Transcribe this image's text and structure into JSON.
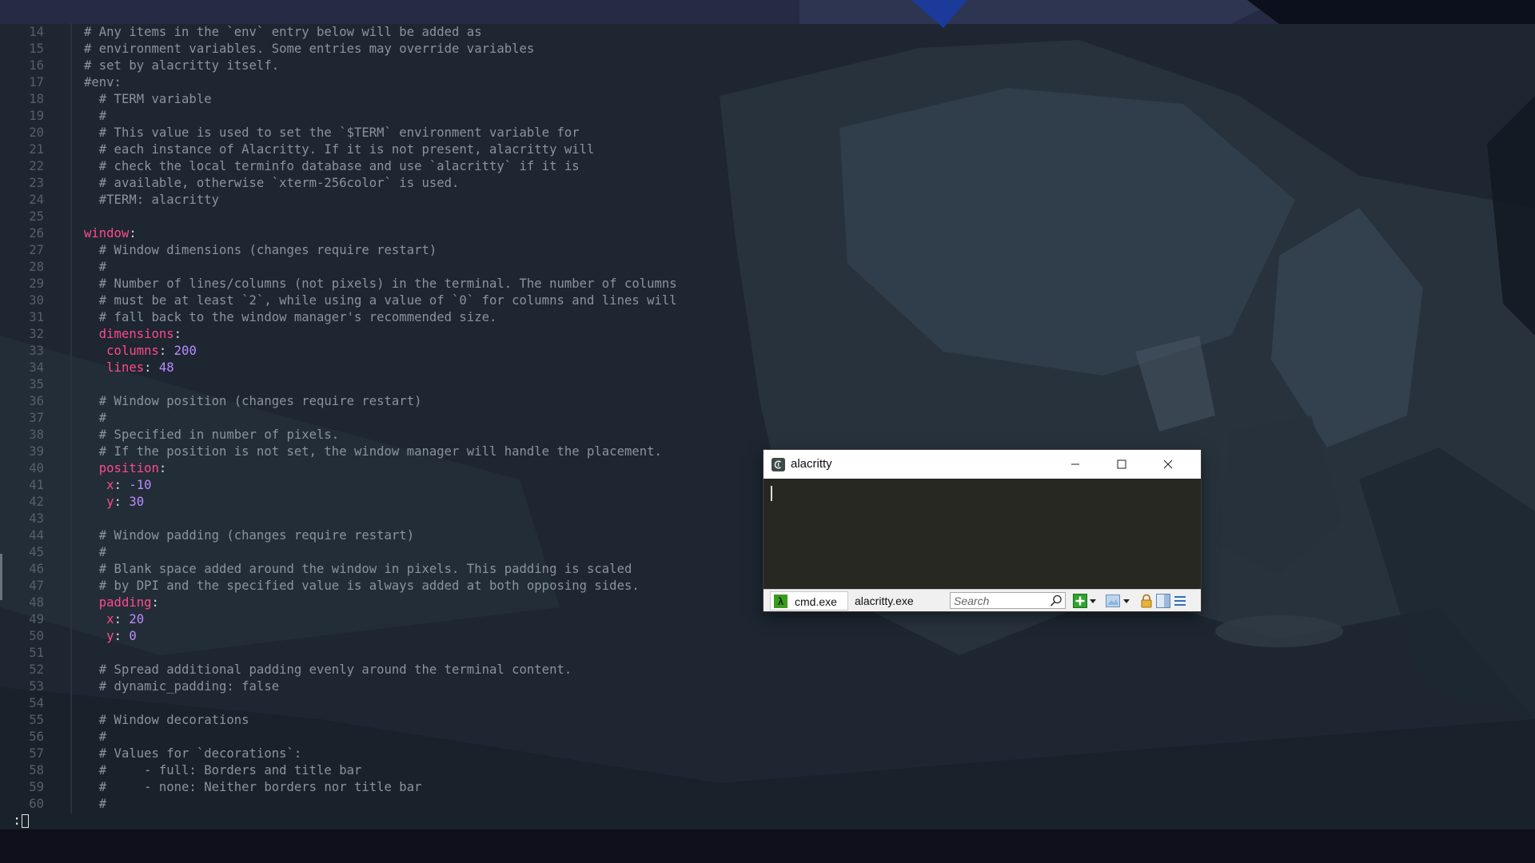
{
  "editor": {
    "lines": [
      {
        "n": "14",
        "s": [
          {
            "t": "# Any items in the `env` entry below will be added as",
            "c": "comment"
          }
        ]
      },
      {
        "n": "15",
        "s": [
          {
            "t": "# environment variables. Some entries may override variables",
            "c": "comment"
          }
        ]
      },
      {
        "n": "16",
        "s": [
          {
            "t": "# set by alacritty itself.",
            "c": "comment"
          }
        ]
      },
      {
        "n": "17",
        "s": [
          {
            "t": "#env:",
            "c": "comment"
          }
        ]
      },
      {
        "n": "18",
        "s": [
          {
            "t": "  # TERM variable",
            "c": "comment"
          }
        ]
      },
      {
        "n": "19",
        "s": [
          {
            "t": "  #",
            "c": "comment"
          }
        ]
      },
      {
        "n": "20",
        "s": [
          {
            "t": "  # This value is used to set the `$TERM` environment variable for",
            "c": "comment"
          }
        ]
      },
      {
        "n": "21",
        "s": [
          {
            "t": "  # each instance of Alacritty. If it is not present, alacritty will",
            "c": "comment"
          }
        ]
      },
      {
        "n": "22",
        "s": [
          {
            "t": "  # check the local terminfo database and use `alacritty` if it is",
            "c": "comment"
          }
        ]
      },
      {
        "n": "23",
        "s": [
          {
            "t": "  # available, otherwise `xterm-256color` is used.",
            "c": "comment"
          }
        ]
      },
      {
        "n": "24",
        "s": [
          {
            "t": "  #TERM: alacritty",
            "c": "comment"
          }
        ]
      },
      {
        "n": "25",
        "s": []
      },
      {
        "n": "26",
        "s": [
          {
            "t": "window",
            "c": "key"
          },
          {
            "t": ":",
            "c": "punct"
          }
        ]
      },
      {
        "n": "27",
        "s": [
          {
            "t": "  # Window dimensions (changes require restart)",
            "c": "comment"
          }
        ]
      },
      {
        "n": "28",
        "s": [
          {
            "t": "  #",
            "c": "comment"
          }
        ]
      },
      {
        "n": "29",
        "s": [
          {
            "t": "  # Number of lines/columns (not pixels) in the terminal. The number of columns",
            "c": "comment"
          }
        ]
      },
      {
        "n": "30",
        "s": [
          {
            "t": "  # must be at least `2`, while using a value of `0` for columns and lines will",
            "c": "comment"
          }
        ]
      },
      {
        "n": "31",
        "s": [
          {
            "t": "  # fall back to the window manager's recommended size.",
            "c": "comment"
          }
        ]
      },
      {
        "n": "32",
        "s": [
          {
            "t": "  dimensions",
            "c": "key"
          },
          {
            "t": ":",
            "c": "punct"
          }
        ]
      },
      {
        "n": "33",
        "s": [
          {
            "t": "   columns",
            "c": "key"
          },
          {
            "t": ": ",
            "c": "punct"
          },
          {
            "t": "200",
            "c": "num"
          }
        ]
      },
      {
        "n": "34",
        "s": [
          {
            "t": "   lines",
            "c": "key"
          },
          {
            "t": ": ",
            "c": "punct"
          },
          {
            "t": "48",
            "c": "num"
          }
        ]
      },
      {
        "n": "35",
        "s": []
      },
      {
        "n": "36",
        "s": [
          {
            "t": "  # Window position (changes require restart)",
            "c": "comment"
          }
        ]
      },
      {
        "n": "37",
        "s": [
          {
            "t": "  #",
            "c": "comment"
          }
        ]
      },
      {
        "n": "38",
        "s": [
          {
            "t": "  # Specified in number of pixels.",
            "c": "comment"
          }
        ]
      },
      {
        "n": "39",
        "s": [
          {
            "t": "  # If the position is not set, the window manager will handle the placement.",
            "c": "comment"
          }
        ]
      },
      {
        "n": "40",
        "s": [
          {
            "t": "  position",
            "c": "key"
          },
          {
            "t": ":",
            "c": "punct"
          }
        ]
      },
      {
        "n": "41",
        "s": [
          {
            "t": "   x",
            "c": "key"
          },
          {
            "t": ": ",
            "c": "punct"
          },
          {
            "t": "-10",
            "c": "num"
          }
        ]
      },
      {
        "n": "42",
        "s": [
          {
            "t": "   y",
            "c": "key"
          },
          {
            "t": ": ",
            "c": "punct"
          },
          {
            "t": "30",
            "c": "num"
          }
        ]
      },
      {
        "n": "43",
        "s": []
      },
      {
        "n": "44",
        "s": [
          {
            "t": "  # Window padding (changes require restart)",
            "c": "comment"
          }
        ]
      },
      {
        "n": "45",
        "s": [
          {
            "t": "  #",
            "c": "comment"
          }
        ]
      },
      {
        "n": "46",
        "s": [
          {
            "t": "  # Blank space added around the window in pixels. This padding is scaled",
            "c": "comment"
          }
        ]
      },
      {
        "n": "47",
        "s": [
          {
            "t": "  # by DPI and the specified value is always added at both opposing sides.",
            "c": "comment"
          }
        ]
      },
      {
        "n": "48",
        "s": [
          {
            "t": "  padding",
            "c": "key"
          },
          {
            "t": ":",
            "c": "punct"
          }
        ]
      },
      {
        "n": "49",
        "s": [
          {
            "t": "   x",
            "c": "key"
          },
          {
            "t": ": ",
            "c": "punct"
          },
          {
            "t": "20",
            "c": "num"
          }
        ]
      },
      {
        "n": "50",
        "s": [
          {
            "t": "   y",
            "c": "key"
          },
          {
            "t": ": ",
            "c": "punct"
          },
          {
            "t": "0",
            "c": "num"
          }
        ]
      },
      {
        "n": "51",
        "s": []
      },
      {
        "n": "52",
        "s": [
          {
            "t": "  # Spread additional padding evenly around the terminal content.",
            "c": "comment"
          }
        ]
      },
      {
        "n": "53",
        "s": [
          {
            "t": "  # dynamic_padding: false",
            "c": "comment"
          }
        ]
      },
      {
        "n": "54",
        "s": []
      },
      {
        "n": "55",
        "s": [
          {
            "t": "  # Window decorations",
            "c": "comment"
          }
        ]
      },
      {
        "n": "56",
        "s": [
          {
            "t": "  #",
            "c": "comment"
          }
        ]
      },
      {
        "n": "57",
        "s": [
          {
            "t": "  # Values for `decorations`:",
            "c": "comment"
          }
        ]
      },
      {
        "n": "58",
        "s": [
          {
            "t": "  #     - full: Borders and title bar",
            "c": "comment"
          }
        ]
      },
      {
        "n": "59",
        "s": [
          {
            "t": "  #     - none: Neither borders nor title bar",
            "c": "comment"
          }
        ]
      },
      {
        "n": "60",
        "s": [
          {
            "t": "  #",
            "c": "comment"
          }
        ]
      }
    ],
    "cmdline": ":"
  },
  "window": {
    "title": "alacritty",
    "icon": "alacritty-app-icon",
    "controls": {
      "minimize": "minimize-icon",
      "maximize": "maximize-icon",
      "close": "close-icon"
    }
  },
  "statusbar": {
    "tabs": [
      {
        "label": "cmd.exe",
        "icon": "lambda-icon"
      },
      {
        "label": "alacritty.exe"
      }
    ],
    "search_placeholder": "Search",
    "icons": [
      "search-icon",
      "new-console-icon",
      "dropdown-arrow-icon",
      "picture-icon",
      "dropdown-arrow-icon",
      "lock-icon",
      "split-view-icon",
      "menu-icon"
    ]
  },
  "colors": {
    "comment": "#8a949c",
    "key": "#ff4a8a",
    "number": "#b88cff",
    "terminal_bg": "#282823",
    "cmd_tab_icon": "#3b9b1e"
  }
}
